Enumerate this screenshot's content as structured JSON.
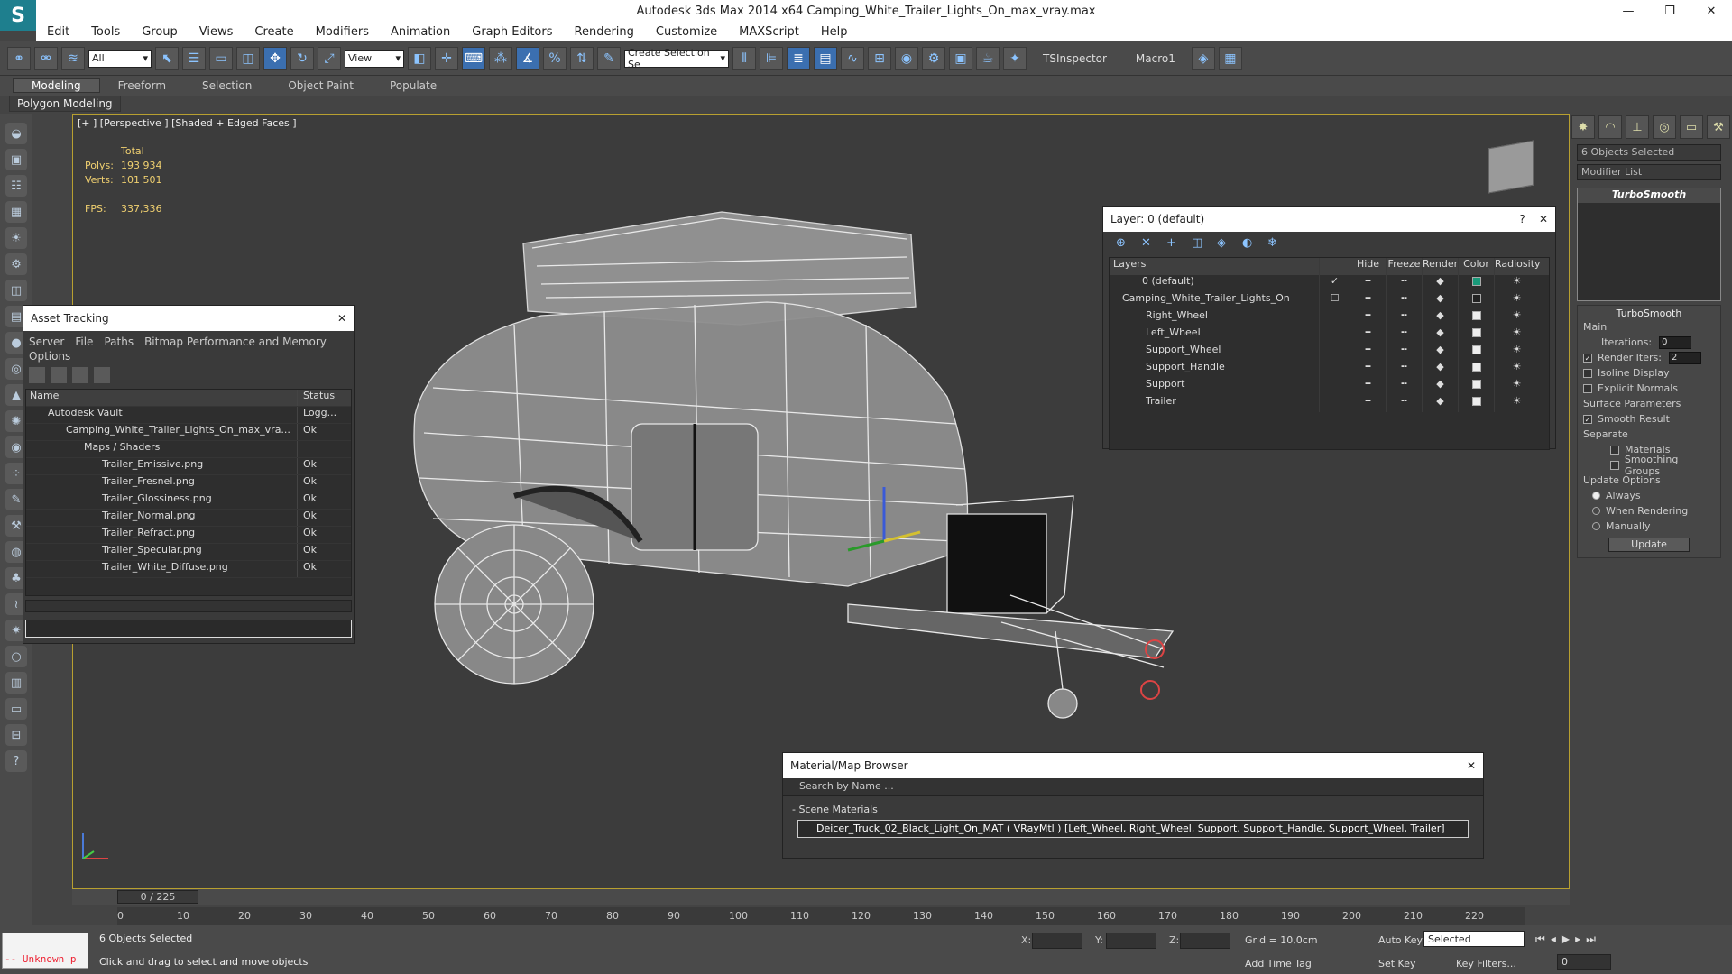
{
  "app": {
    "title": "Autodesk 3ds Max  2014 x64      Camping_White_Trailer_Lights_On_max_vray.max",
    "logo": "S"
  },
  "window_buttons": [
    "—",
    "❐",
    "✕"
  ],
  "menu": [
    "Edit",
    "Tools",
    "Group",
    "Views",
    "Create",
    "Modifiers",
    "Animation",
    "Graph Editors",
    "Rendering",
    "Customize",
    "MAXScript",
    "Help"
  ],
  "toolbar": {
    "filter": "All",
    "view": "View",
    "selection_set": "Create Selection Se",
    "tsinspector": "TSInspector",
    "macro": "Macro1"
  },
  "ribbon": {
    "tabs": [
      "Modeling",
      "Freeform",
      "Selection",
      "Object Paint",
      "Populate"
    ],
    "active": "Modeling",
    "sub": "Polygon Modeling"
  },
  "viewport": {
    "label": "[+ ] [Perspective ] [Shaded + Edged Faces ]",
    "stats": {
      "total": "Total",
      "polys_label": "Polys:",
      "polys": "193 934",
      "verts_label": "Verts:",
      "verts": "101 501",
      "fps_label": "FPS:",
      "fps": "337,336"
    }
  },
  "asset_tracking": {
    "title": "Asset Tracking",
    "menu": [
      "Server",
      "File",
      "Paths",
      "Bitmap Performance and Memory",
      "Options"
    ],
    "columns": [
      "Name",
      "Status"
    ],
    "rows": [
      {
        "name": "Autodesk Vault",
        "status": "Logg...",
        "indent": 1
      },
      {
        "name": "Camping_White_Trailer_Lights_On_max_vra...",
        "status": "Ok",
        "indent": 2
      },
      {
        "name": "Maps / Shaders",
        "status": "",
        "indent": 3
      },
      {
        "name": "Trailer_Emissive.png",
        "status": "Ok",
        "indent": 4
      },
      {
        "name": "Trailer_Fresnel.png",
        "status": "Ok",
        "indent": 4
      },
      {
        "name": "Trailer_Glossiness.png",
        "status": "Ok",
        "indent": 4
      },
      {
        "name": "Trailer_Normal.png",
        "status": "Ok",
        "indent": 4
      },
      {
        "name": "Trailer_Refract.png",
        "status": "Ok",
        "indent": 4
      },
      {
        "name": "Trailer_Specular.png",
        "status": "Ok",
        "indent": 4
      },
      {
        "name": "Trailer_White_Diffuse.png",
        "status": "Ok",
        "indent": 4
      }
    ]
  },
  "layers": {
    "title": "Layer: 0 (default)",
    "columns": [
      "Layers",
      "Hide",
      "Freeze",
      "Render",
      "Color",
      "Radiosity"
    ],
    "rows": [
      {
        "name": "0 (default)",
        "color": "#1a9a7a",
        "indent": 1,
        "check": "✓"
      },
      {
        "name": "Camping_White_Trailer_Lights_On",
        "color": "#222222",
        "indent": 0,
        "check": "☐"
      },
      {
        "name": "Right_Wheel",
        "color": "#eeeeee",
        "indent": 2,
        "check": ""
      },
      {
        "name": "Left_Wheel",
        "color": "#eeeeee",
        "indent": 2,
        "check": ""
      },
      {
        "name": "Support_Wheel",
        "color": "#eeeeee",
        "indent": 2,
        "check": ""
      },
      {
        "name": "Support_Handle",
        "color": "#eeeeee",
        "indent": 2,
        "check": ""
      },
      {
        "name": "Support",
        "color": "#eeeeee",
        "indent": 2,
        "check": ""
      },
      {
        "name": "Trailer",
        "color": "#eeeeee",
        "indent": 2,
        "check": ""
      }
    ]
  },
  "material_browser": {
    "title": "Material/Map Browser",
    "search_placeholder": "Search by Name ...",
    "section": "- Scene Materials",
    "item": "Deicer_Truck_02_Black_Light_On_MAT  ( VRayMtl )  [Left_Wheel, Right_Wheel, Support, Support_Handle, Support_Wheel, Trailer]"
  },
  "command_panel": {
    "objects_selected": "6 Objects Selected",
    "modifier_list": "Modifier List",
    "stack_item": "TurboSmooth",
    "rollout_title": "TurboSmooth",
    "main": "Main",
    "iterations_label": "Iterations:",
    "iterations": "0",
    "render_iters_label": "Render Iters:",
    "render_iters": "2",
    "isoline": "Isoline Display",
    "explicit_normals": "Explicit Normals",
    "surface_params": "Surface Parameters",
    "smooth_result": "Smooth Result",
    "separate": "Separate",
    "materials": "Materials",
    "smoothing_groups": "Smoothing Groups",
    "update_options": "Update Options",
    "always": "Always",
    "when_rendering": "When Rendering",
    "manually": "Manually",
    "update": "Update"
  },
  "timeline": {
    "frame": "0 / 225",
    "ticks": [
      "0",
      "10",
      "20",
      "30",
      "40",
      "50",
      "60",
      "70",
      "80",
      "90",
      "100",
      "110",
      "120",
      "130",
      "140",
      "150",
      "160",
      "170",
      "180",
      "190",
      "200",
      "210",
      "220"
    ]
  },
  "status": {
    "unknown": "-- Unknown p",
    "selected": "6 Objects Selected",
    "hint": "Click and drag to select and move objects",
    "x": "X:",
    "y": "Y:",
    "z": "Z:",
    "grid": "Grid = 10,0cm",
    "add_time_tag": "Add Time Tag",
    "auto_key": "Auto Key",
    "set_key": "Set Key",
    "selected_drop": "Selected",
    "key_filters": "Key Filters...",
    "frame": "0"
  }
}
